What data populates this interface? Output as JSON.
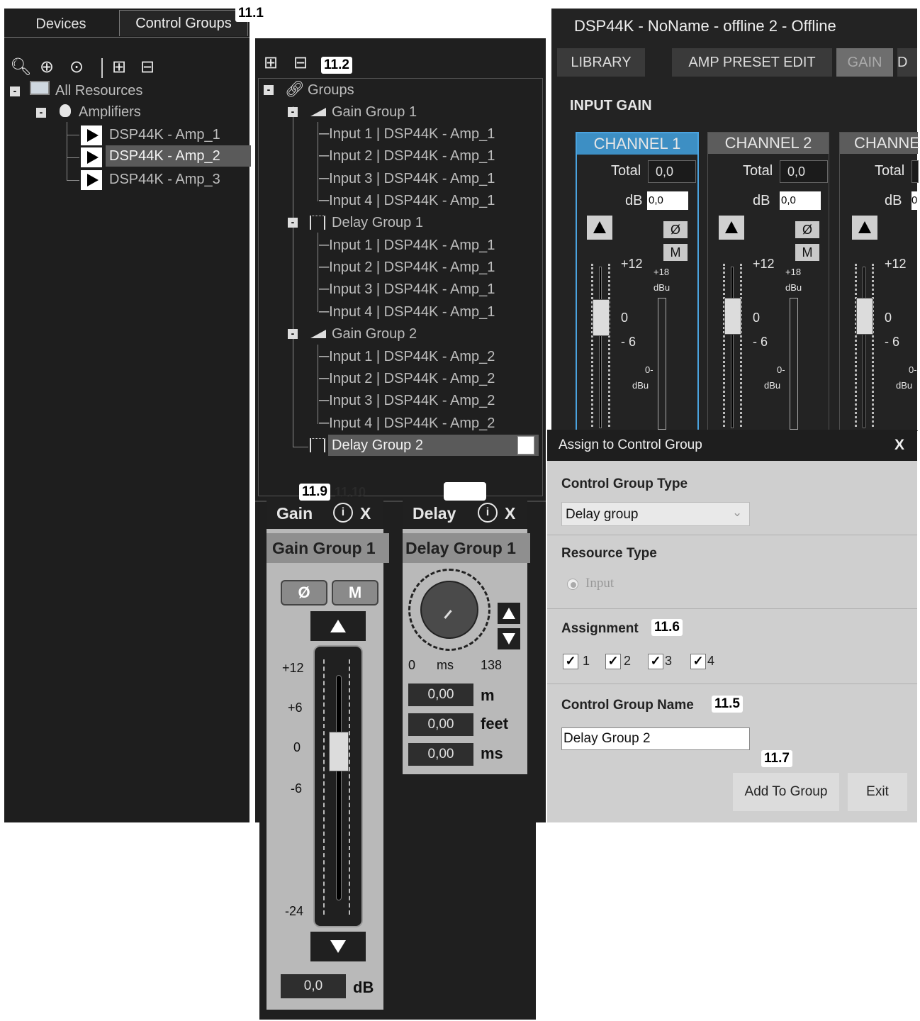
{
  "callouts": {
    "c11_1": "11.1",
    "c11_2": "11.2",
    "c11_9": "11.9",
    "c11_10": "11.10",
    "c11_6": "11.6",
    "c11_5": "11.5",
    "c11_7": "11.7"
  },
  "left": {
    "tabs": [
      "Devices",
      "Control Groups"
    ],
    "tree": {
      "root": "All Resources",
      "amplifiers": "Amplifiers",
      "items": [
        "DSP44K - Amp_1",
        "DSP44K - Amp_2",
        "DSP44K - Amp_3"
      ]
    }
  },
  "mid": {
    "root": "Groups",
    "groups": [
      {
        "label": "Gain Group 1",
        "inputs": [
          "Input 1 | DSP44K - Amp_1",
          "Input 2 | DSP44K - Amp_1",
          "Input 3 | DSP44K - Amp_1",
          "Input 4 | DSP44K - Amp_1"
        ]
      },
      {
        "label": "Delay Group 1",
        "inputs": [
          "Input 1 | DSP44K - Amp_1",
          "Input 2 | DSP44K - Amp_1",
          "Input 3 | DSP44K - Amp_1",
          "Input 4 | DSP44K - Amp_1"
        ]
      },
      {
        "label": "Gain Group 2",
        "inputs": [
          "Input 1 | DSP44K - Amp_2",
          "Input 2 | DSP44K - Amp_2",
          "Input 3 | DSP44K - Amp_2",
          "Input 4 | DSP44K - Amp_2"
        ]
      },
      {
        "label": "Delay Group 2",
        "inputs": []
      }
    ]
  },
  "right": {
    "title": "DSP44K - NoName - offline 2 - Offline",
    "tabs": [
      "LIBRARY",
      "AMP PRESET EDIT",
      "GAIN",
      "D"
    ],
    "section": "INPUT GAIN",
    "channels": [
      {
        "name": "CHANNEL 1",
        "total_label": "Total",
        "total": "0,0",
        "db_label": "dB",
        "db": "0,0"
      },
      {
        "name": "CHANNEL 2",
        "total_label": "Total",
        "total": "0,0",
        "db_label": "dB",
        "db": "0,0"
      },
      {
        "name": "CHANNE",
        "total_label": "Total",
        "total": "",
        "db_label": "dB",
        "db": "0"
      }
    ],
    "phase": "Ø",
    "mute": "M",
    "scale": {
      "p12": "+12",
      "zero": "0",
      "m6": "- 6"
    },
    "meter": {
      "top": "+18",
      "unit": "dBu",
      "zero": "0-",
      "unit2": "dBu"
    }
  },
  "dialog": {
    "title": "Assign to Control Group",
    "close": "X",
    "type_label": "Control Group Type",
    "type_value": "Delay group",
    "resource_label": "Resource Type",
    "resource_value": "Input",
    "assignment_label": "Assignment",
    "assignments": [
      "1",
      "2",
      "3",
      "4"
    ],
    "name_label": "Control Group Name",
    "name_value": "Delay Group 2",
    "add_button": "Add To Group",
    "exit_button": "Exit"
  },
  "gain_widget": {
    "title": "Gain",
    "close": "X",
    "group": "Gain Group 1",
    "phase": "Ø",
    "mute": "M",
    "scale": [
      "+12",
      "+6",
      "0",
      "-6",
      "-24"
    ],
    "value": "0,0",
    "unit": "dB",
    "fader_level": 0.33
  },
  "delay_widget": {
    "title": "Delay",
    "close": "X",
    "group": "Delay Group 1",
    "min": "0",
    "unit": "ms",
    "max": "138",
    "rows": [
      {
        "value": "0,00",
        "unit": "m"
      },
      {
        "value": "0,00",
        "unit": "feet"
      },
      {
        "value": "0,00",
        "unit": "ms"
      }
    ]
  }
}
